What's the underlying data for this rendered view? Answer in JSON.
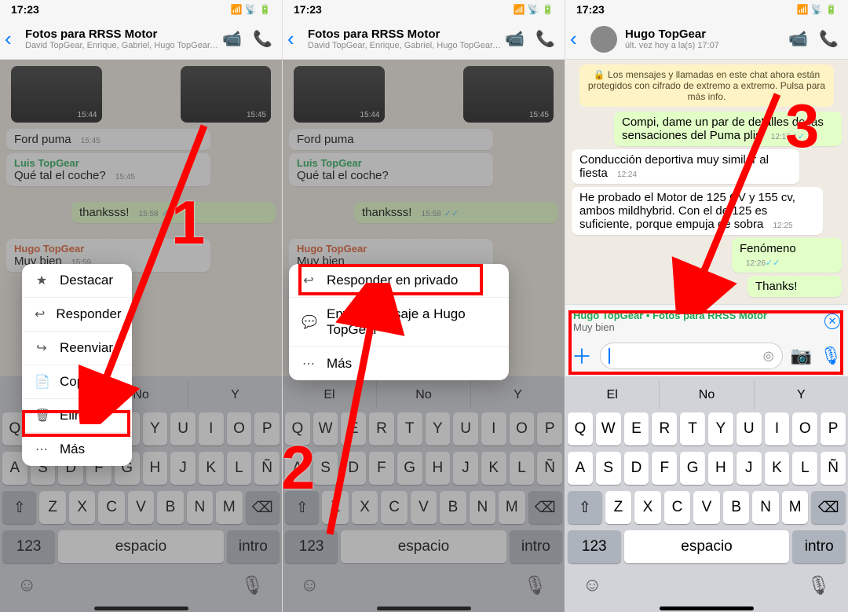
{
  "status_time": "17:23",
  "group_chat": {
    "title": "Fotos para RRSS Motor",
    "subtitle": "David TopGear, Enrique, Gabriel, Hugo TopGear, Ki…",
    "thumb_ts": "15:44",
    "thumb_ts2": "15:45",
    "msg_ford": "Ford puma",
    "ford_ts": "15:45",
    "sender_luis": "Luis TopGear",
    "msg_luis": "Qué tal el coche?",
    "luis_ts": "15:45",
    "msg_thanks": "thanksss!",
    "thanks_ts": "15:58",
    "sender_hugo": "Hugo TopGear",
    "msg_hugo": "Muy bien",
    "hugo_ts": "15:59"
  },
  "menu1": {
    "destacar": "Destacar",
    "responder": "Responder",
    "reenviar": "Reenviar",
    "copiar": "Copiar",
    "eliminar": "Eliminar",
    "mas": "Más"
  },
  "menu2": {
    "resp_priv": "Responder en privado",
    "enviar_a": "Enviar mensaje a Hugo TopGear",
    "mas": "Más"
  },
  "keyboard": {
    "sugg_left": "El",
    "sugg_mid": "No",
    "sugg_right": "Y",
    "r1": [
      "Q",
      "W",
      "E",
      "R",
      "T",
      "Y",
      "U",
      "I",
      "O",
      "P"
    ],
    "r2": [
      "A",
      "S",
      "D",
      "F",
      "G",
      "H",
      "J",
      "K",
      "L",
      "Ñ"
    ],
    "r3": [
      "Z",
      "X",
      "C",
      "V",
      "B",
      "N",
      "M"
    ],
    "num": "123",
    "space": "espacio",
    "intro": "intro"
  },
  "pane3": {
    "title": "Hugo TopGear",
    "subtitle": "últ. vez hoy a la(s) 17:07",
    "banner": "🔒 Los mensajes y llamadas en este chat ahora están protegidos con cifrado de extremo a extremo. Pulsa para más info.",
    "out1": "Compi, dame un par de detalles de las sensaciones del Puma plis",
    "out1_ts": "12:17",
    "in1": "Conducción deportiva muy similar al fiesta",
    "in1_ts": "12:24",
    "in2": "He probado el Motor de 125 CV y 155 cv, ambos mildhybrid. Con el de 125 es suficiente, porque empuja de sobra",
    "in2_ts": "12:25",
    "out2": "Fenómeno",
    "out2_ts": "12:26",
    "out3": "Thanks!",
    "reply_title": "Hugo TopGear • Fotos para RRSS Motor",
    "reply_text": "Muy bien"
  },
  "steps": {
    "s1": "1",
    "s2": "2",
    "s3": "3"
  }
}
